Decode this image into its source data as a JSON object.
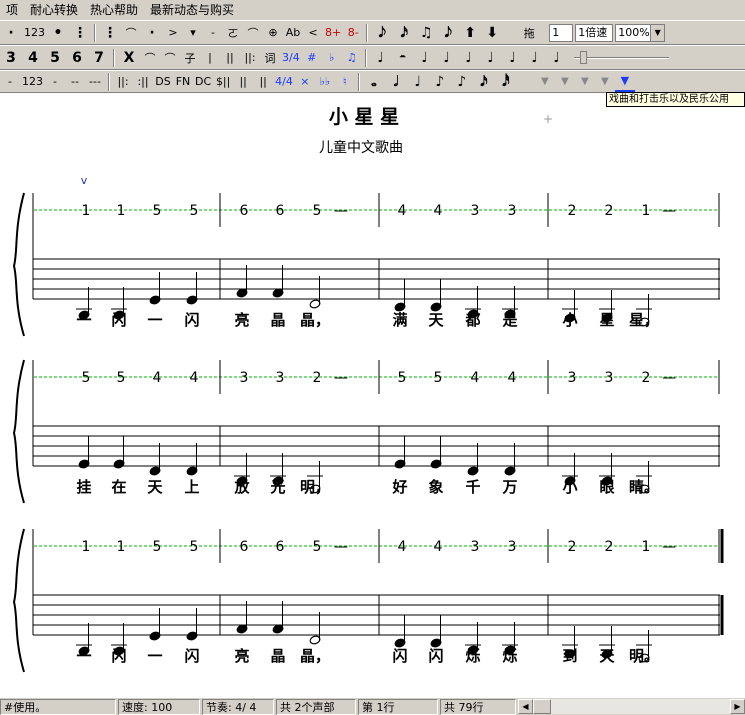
{
  "menubar": {
    "items": [
      "项",
      "耐心转换",
      "热心帮助",
      "最新动态与购买"
    ]
  },
  "toolbar1": {
    "buttons": [
      "·",
      "123",
      "•",
      "⋮",
      "⋮",
      "⌒",
      "·",
      ">",
      "▾",
      "-",
      "ㄛ",
      "⌒",
      "⊕",
      "Ab",
      "<",
      "8+",
      "8-"
    ],
    "duration_buttons": [
      "𝅘𝅥𝅮",
      "𝅘𝅥𝅯",
      "♫",
      "𝅘𝅥𝅮",
      "⬆",
      "⬇"
    ],
    "drag_label": "拖",
    "speed_value": "1",
    "speed_label": "1倍速",
    "zoom_value": "100%"
  },
  "toolbar2": {
    "numbers": [
      "3",
      "4",
      "5",
      "6",
      "7"
    ],
    "marks": [
      "X",
      "⌒",
      "⌒",
      "子",
      "|",
      "||",
      "||:",
      "词"
    ],
    "time_sig_1": "3/4",
    "sharp": "#",
    "flat": "♭",
    "beam": "♫",
    "notes": [
      "♩",
      "𝄼",
      "♩",
      "♩",
      "♩",
      "♩",
      "♩",
      "♩",
      "♩"
    ]
  },
  "toolbar3": {
    "marks": [
      "-",
      "123",
      "-",
      "--",
      "---"
    ],
    "repeat_marks": [
      "||:",
      ":||",
      "DS",
      "FN",
      "DC",
      "$||",
      "||",
      "||",
      ":||"
    ],
    "time_sig_2": "4/4",
    "cross": "×",
    "double_flat": "♭♭",
    "natural": "♮",
    "note_values": [
      "𝅝",
      "𝅗𝅥",
      "♩",
      "♪",
      "♪",
      "𝅘𝅥𝅯",
      "𝅘𝅥𝅰"
    ]
  },
  "tooltip": "戏曲和打击乐以及民乐公用",
  "score": {
    "title": "小 星 星",
    "subtitle": "儿童中文歌曲",
    "breath_mark": "v",
    "systems": [
      {
        "jianpu": [
          [
            "1",
            "1",
            "5",
            "5"
          ],
          [
            "6",
            "6",
            "5",
            "—"
          ],
          [
            "4",
            "4",
            "3",
            "3"
          ],
          [
            "2",
            "2",
            "1",
            "—"
          ]
        ],
        "lyrics": [
          [
            "一",
            "闪",
            "一",
            "闪"
          ],
          [
            "亮",
            "晶",
            "晶，"
          ],
          [
            "满",
            "天",
            "都",
            "是"
          ],
          [
            "小",
            "星",
            "星，"
          ]
        ]
      },
      {
        "jianpu": [
          [
            "5",
            "5",
            "4",
            "4"
          ],
          [
            "3",
            "3",
            "2",
            "—"
          ],
          [
            "5",
            "5",
            "4",
            "4"
          ],
          [
            "3",
            "3",
            "2",
            "—"
          ]
        ],
        "lyrics": [
          [
            "挂",
            "在",
            "天",
            "上"
          ],
          [
            "放",
            "光",
            "明，"
          ],
          [
            "好",
            "象",
            "千",
            "万"
          ],
          [
            "小",
            "眼",
            "睛。"
          ]
        ]
      },
      {
        "jianpu": [
          [
            "1",
            "1",
            "5",
            "5"
          ],
          [
            "6",
            "6",
            "5",
            "—"
          ],
          [
            "4",
            "4",
            "3",
            "3"
          ],
          [
            "2",
            "2",
            "1",
            "—"
          ]
        ],
        "lyrics": [
          [
            "一",
            "闪",
            "一",
            "闪"
          ],
          [
            "亮",
            "晶",
            "晶，"
          ],
          [
            "闪",
            "闪",
            "烁",
            "烁"
          ],
          [
            "到",
            "天",
            "明。"
          ]
        ]
      }
    ]
  },
  "statusbar": {
    "ready": "#使用。",
    "tempo": "速度: 100",
    "meter": "节奏: 4/ 4",
    "voices": "共 2个声部",
    "current_line": "第 1行",
    "total_lines": "共 79行"
  },
  "colors": {
    "guide_line": "#00b000",
    "breath": "#3030c0"
  }
}
